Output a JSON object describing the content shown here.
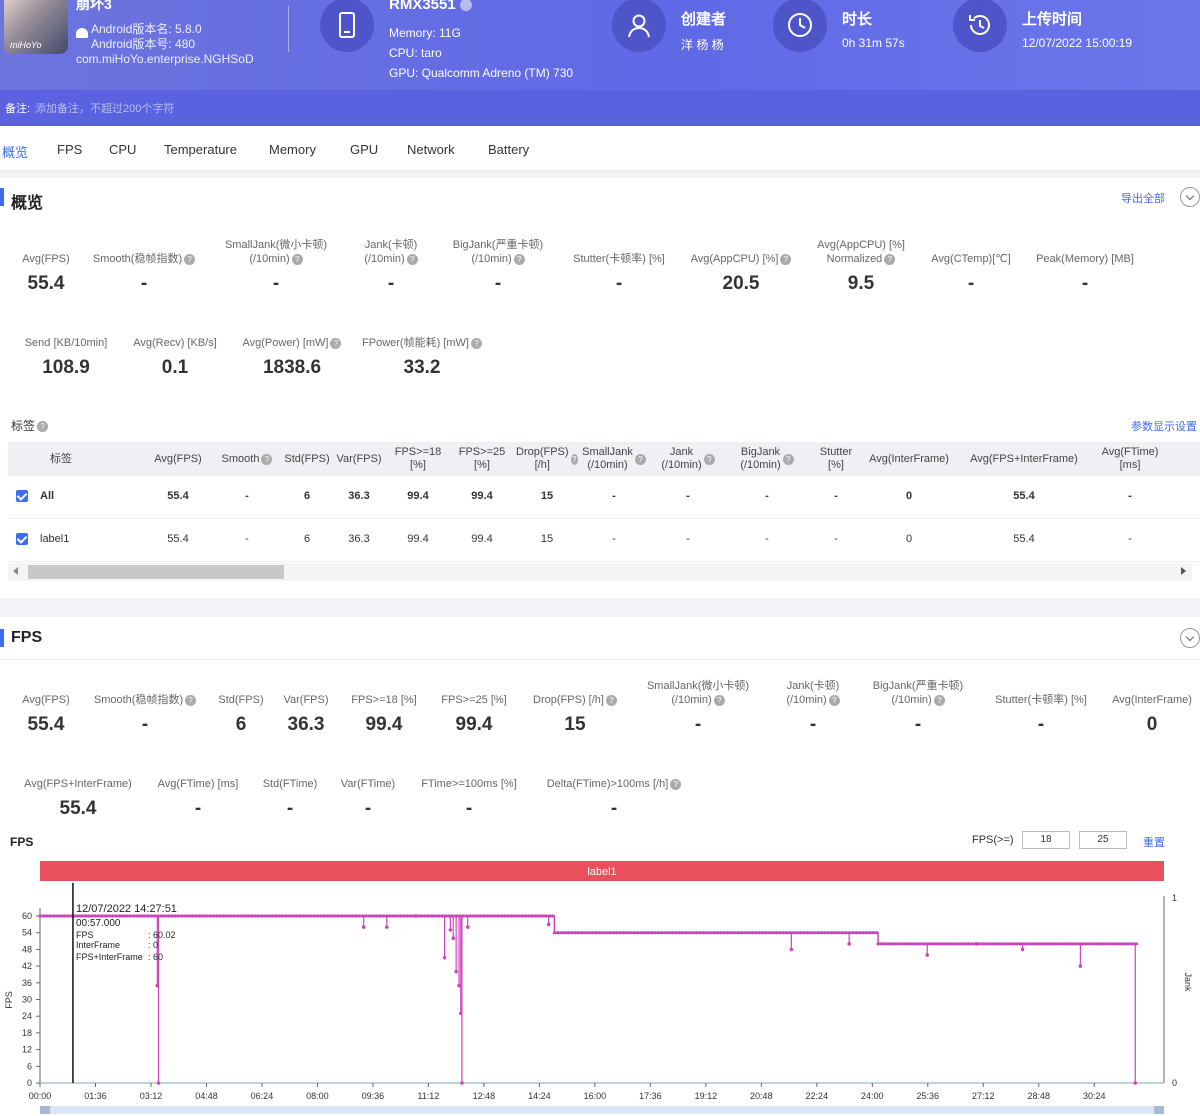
{
  "header": {
    "app_name": "崩坏3",
    "app_icon_brand": "miHoYo",
    "android_version_name": "Android版本名: 5.8.0",
    "android_version_code": "Android版本号: 480",
    "package": "com.miHoYo.enterprise.NGHSoD",
    "device_model": "RMX3551",
    "memory": "Memory: 11G",
    "cpu": "CPU: taro",
    "gpu": "GPU: Qualcomm Adreno (TM) 730",
    "creator_title": "创建者",
    "creator_value": "洋 杨 杨",
    "duration_title": "时长",
    "duration_value": "0h 31m 57s",
    "upload_title": "上传时间",
    "upload_value": "12/07/2022 15:00:19",
    "note_label": "备注:",
    "note_placeholder": "添加备注，不超过200个字符"
  },
  "tabs": [
    "概览",
    "FPS",
    "CPU",
    "Temperature",
    "Memory",
    "GPU",
    "Network",
    "Battery"
  ],
  "overview": {
    "title": "概览",
    "export_all": "导出全部",
    "metrics_row1": [
      {
        "label": "Avg(FPS)",
        "value": "55.4"
      },
      {
        "label": "Smooth(稳帧指数)",
        "value": "-"
      },
      {
        "label": "SmallJank(微小卡顿)",
        "label2": "(/10min)",
        "value": "-"
      },
      {
        "label": "Jank(卡顿)",
        "label2": "(/10min)",
        "value": "-"
      },
      {
        "label": "BigJank(严重卡顿)",
        "label2": "(/10min)",
        "value": "-"
      },
      {
        "label": "Stutter(卡顿率) [%]",
        "value": "-"
      },
      {
        "label": "Avg(AppCPU) [%]",
        "value": "20.5"
      },
      {
        "label": "Avg(AppCPU) [%]",
        "label2": "Normalized",
        "value": "9.5"
      },
      {
        "label": "Avg(CTemp)[℃]",
        "value": "-"
      },
      {
        "label": "Peak(Memory) [MB]",
        "value": "-"
      }
    ],
    "metrics_row2": [
      {
        "label": "Send [KB/10min]",
        "value": "108.9"
      },
      {
        "label": "Avg(Recv) [KB/s]",
        "value": "0.1"
      },
      {
        "label": "Avg(Power) [mW]",
        "value": "1838.6"
      },
      {
        "label": "FPower(帧能耗) [mW]",
        "value": "33.2"
      }
    ],
    "tags_title": "标签",
    "param_settings": "参数显示设置",
    "table_headers": [
      "标签",
      "Avg(FPS)",
      "Smooth",
      "Std(FPS)",
      "Var(FPS)",
      "FPS>=18\n[%]",
      "FPS>=25\n[%]",
      "Drop(FPS)\n[/h]",
      "SmallJank\n(/10min)",
      "Jank\n(/10min)",
      "BigJank\n(/10min)",
      "Stutter\n[%]",
      "Avg(InterFrame)",
      "Avg(FPS+InterFrame)",
      "Avg(FTime)\n[ms]"
    ],
    "table_rows": [
      [
        "All",
        "55.4",
        "-",
        "6",
        "36.3",
        "99.4",
        "99.4",
        "15",
        "-",
        "-",
        "-",
        "-",
        "0",
        "55.4",
        "-"
      ],
      [
        "label1",
        "55.4",
        "-",
        "6",
        "36.3",
        "99.4",
        "99.4",
        "15",
        "-",
        "-",
        "-",
        "-",
        "0",
        "55.4",
        "-"
      ]
    ]
  },
  "fps_section": {
    "title": "FPS",
    "metrics_row1": [
      {
        "label": "Avg(FPS)",
        "value": "55.4"
      },
      {
        "label": "Smooth(稳帧指数)",
        "value": "-"
      },
      {
        "label": "Std(FPS)",
        "value": "6"
      },
      {
        "label": "Var(FPS)",
        "value": "36.3"
      },
      {
        "label": "FPS>=18 [%]",
        "value": "99.4"
      },
      {
        "label": "FPS>=25 [%]",
        "value": "99.4"
      },
      {
        "label": "Drop(FPS) [/h]",
        "value": "15"
      },
      {
        "label": "SmallJank(微小卡顿)",
        "label2": "(/10min)",
        "value": "-"
      },
      {
        "label": "Jank(卡顿)",
        "label2": "(/10min)",
        "value": "-"
      },
      {
        "label": "BigJank(严重卡顿)",
        "label2": "(/10min)",
        "value": "-"
      },
      {
        "label": "Stutter(卡顿率) [%]",
        "value": "-"
      },
      {
        "label": "Avg(InterFrame)",
        "value": "0"
      }
    ],
    "metrics_row2": [
      {
        "label": "Avg(FPS+InterFrame)",
        "value": "55.4"
      },
      {
        "label": "Avg(FTime) [ms]",
        "value": "-"
      },
      {
        "label": "Std(FTime)",
        "value": "-"
      },
      {
        "label": "Var(FTime)",
        "value": "-"
      },
      {
        "label": "FTime>=100ms [%]",
        "value": "-"
      },
      {
        "label": "Delta(FTime)>100ms [/h]",
        "value": "-"
      }
    ],
    "chart_title": "FPS",
    "threshold_label": "FPS(>=)",
    "threshold_1": "18",
    "threshold_2": "25",
    "reset": "重置",
    "label_band": "label1",
    "tooltip": {
      "time": "12/07/2022 14:27:51",
      "elapsed": "00:57.000",
      "fps_label": "FPS",
      "fps_value": ": 60.02",
      "interframe_label": "InterFrame",
      "interframe_value": ": 0",
      "fps_inter_label": "FPS+InterFrame",
      "fps_inter_value": ": 60"
    }
  },
  "chart_data": {
    "type": "line",
    "title": "FPS",
    "xlabel": "",
    "ylabel": "FPS",
    "y2label": "Jank",
    "ylim": [
      0,
      60
    ],
    "y2lim": [
      0,
      1
    ],
    "yticks": [
      0,
      6,
      12,
      18,
      24,
      30,
      36,
      42,
      48,
      54,
      60
    ],
    "xticks": [
      "00:00",
      "01:36",
      "03:12",
      "04:48",
      "06:24",
      "08:00",
      "09:36",
      "11:12",
      "12:48",
      "14:24",
      "16:00",
      "17:36",
      "19:12",
      "20:48",
      "22:24",
      "24:00",
      "25:36",
      "27:12",
      "28:48",
      "30:24"
    ],
    "x_seconds_range": [
      0,
      1917
    ],
    "cursor_seconds": 57,
    "series": [
      {
        "name": "FPS",
        "color": "#cc44bb",
        "segments": [
          {
            "from": 0,
            "to": 890,
            "level": 60
          },
          {
            "from": 890,
            "to": 1450,
            "level": 54
          },
          {
            "from": 1450,
            "to": 1900,
            "level": 50
          }
        ],
        "dips": [
          [
            205,
            0
          ],
          [
            203,
            35
          ],
          [
            560,
            56
          ],
          [
            600,
            56
          ],
          [
            650,
            60
          ],
          [
            700,
            45
          ],
          [
            720,
            40
          ],
          [
            715,
            52
          ],
          [
            710,
            55
          ],
          [
            725,
            35
          ],
          [
            730,
            0
          ],
          [
            728,
            25
          ],
          [
            740,
            56
          ],
          [
            880,
            57
          ],
          [
            1300,
            48
          ],
          [
            1400,
            50
          ],
          [
            1535,
            46
          ],
          [
            1620,
            50
          ],
          [
            1700,
            48
          ],
          [
            1800,
            42
          ],
          [
            1895,
            0
          ]
        ]
      }
    ],
    "label_bands": [
      {
        "name": "label1",
        "color": "#e8505b"
      }
    ]
  }
}
